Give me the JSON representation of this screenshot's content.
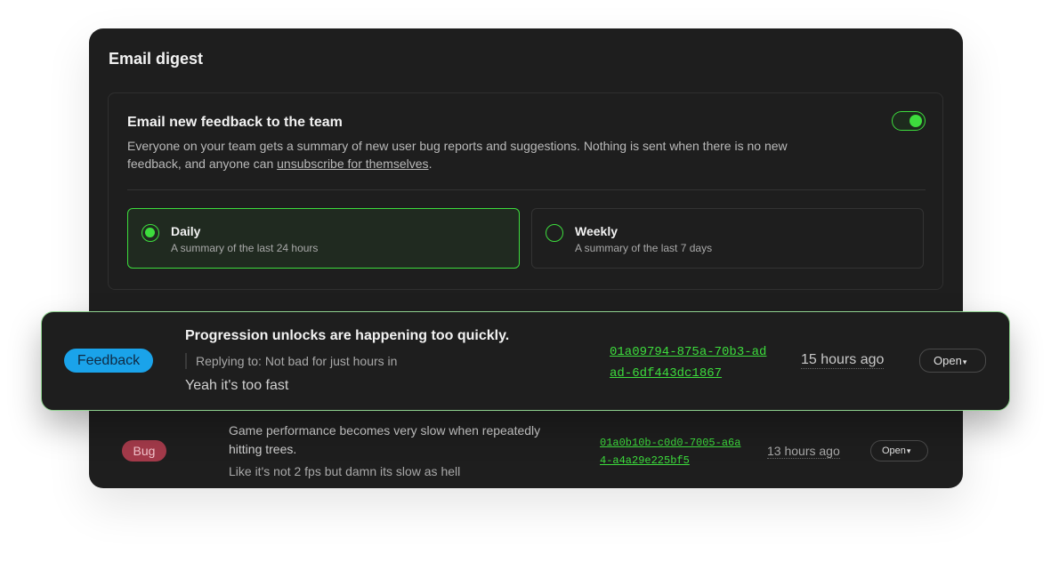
{
  "panel": {
    "title": "Email digest"
  },
  "feedback_card": {
    "heading": "Email new feedback to the team",
    "description_prefix": "Everyone on your team gets a summary of new user bug reports and suggestions. Nothing is sent when there is no new feedback, and anyone can ",
    "description_link": "unsubscribe for themselves",
    "description_suffix": ".",
    "toggle_on": true,
    "accent_color": "#3ddc3d"
  },
  "frequency_options": [
    {
      "label": "Daily",
      "sub": "A summary of the last 24 hours",
      "selected": true
    },
    {
      "label": "Weekly",
      "sub": "A summary of the last 7 days",
      "selected": false
    }
  ],
  "rows": [
    {
      "badge": "Feedback",
      "badge_color": "#1aa3ea",
      "title": "Progression unlocks are happening too quickly.",
      "reply": "Replying to: Not bad for just hours in",
      "message": "Yeah it's too fast",
      "id": "01a09794-875a-70b3-adad-6df443dc1867",
      "time": "15 hours ago",
      "action": "Open",
      "caret_icon": "caret-down-icon"
    },
    {
      "badge": "Bug",
      "badge_color": "#a33a4a",
      "title": "Game performance becomes very slow when repeatedly hitting trees.",
      "message": "Like it's not 2 fps but damn its slow as hell",
      "id": "01a0b10b-c0d0-7005-a6a4-a4a29e225bf5",
      "time": "13 hours ago",
      "action": "Open",
      "caret_icon": "caret-down-icon"
    }
  ]
}
